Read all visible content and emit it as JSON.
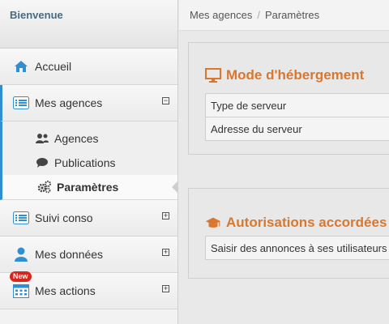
{
  "sidebar": {
    "welcome": "Bienvenue",
    "items": [
      {
        "label": "Accueil",
        "icon": "home-icon"
      },
      {
        "label": "Mes agences",
        "icon": "list-icon",
        "toggle": "−"
      },
      {
        "label": "Suivi conso",
        "icon": "list-icon",
        "toggle": "+"
      },
      {
        "label": "Mes données",
        "icon": "user-icon",
        "toggle": "+"
      },
      {
        "label": "Mes actions",
        "icon": "calendar-icon",
        "toggle": "+",
        "badge": "New"
      }
    ],
    "sub_items": [
      {
        "label": "Agences",
        "icon": "users-icon"
      },
      {
        "label": "Publications",
        "icon": "comment-icon"
      },
      {
        "label": "Paramètres",
        "icon": "gears-icon"
      }
    ]
  },
  "breadcrumb": {
    "parent": "Mes agences",
    "separator": "/",
    "current": "Paramètres"
  },
  "panels": {
    "hosting": {
      "title": "Mode d'hébergement",
      "icon": "monitor-icon",
      "rows": [
        "Type de serveur",
        "Adresse du serveur"
      ]
    },
    "permissions": {
      "title": "Autorisations accordées",
      "icon": "graduation-cap-icon",
      "rows": [
        "Saisir des annonces à ses utilisateurs"
      ]
    }
  },
  "colors": {
    "accent": "#2f8fd0",
    "title": "#d9772e",
    "badge": "#d9261c"
  }
}
